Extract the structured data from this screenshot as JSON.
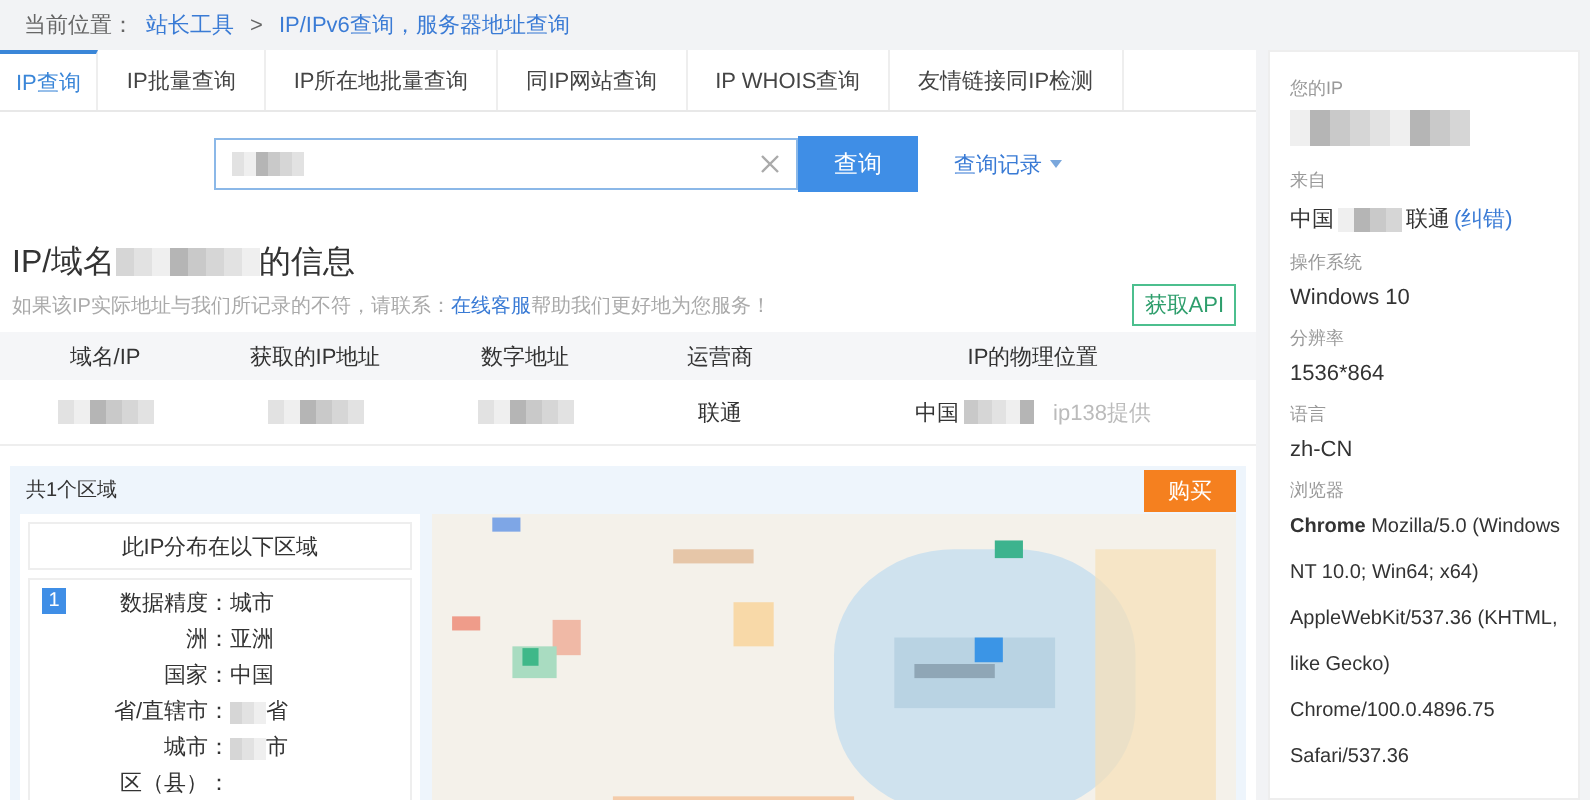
{
  "breadcrumb": {
    "label": "当前位置：",
    "separator": ">",
    "items": [
      "站长工具",
      "IP/IPv6查询，服务器地址查询"
    ]
  },
  "tabs": [
    {
      "label": "IP查询",
      "selected": true
    },
    {
      "label": "IP批量查询",
      "selected": false
    },
    {
      "label": "IP所在地批量查询",
      "selected": false
    },
    {
      "label": "同IP网站查询",
      "selected": false
    },
    {
      "label": "IP WHOIS查询",
      "selected": false
    },
    {
      "label": "友情链接同IP检测",
      "selected": false
    }
  ],
  "search": {
    "button": "查询",
    "history_link": "查询记录"
  },
  "info": {
    "title_prefix": "IP/域名",
    "title_suffix": "的信息",
    "notice_before": "如果该IP实际地址与我们所记录的不符，请联系：",
    "notice_link": "在线客服",
    "notice_after": "帮助我们更好地为您服务！",
    "api_button": "获取API"
  },
  "table": {
    "columns": [
      "域名/IP",
      "获取的IP地址",
      "数字地址",
      "运营商",
      "IP的物理位置"
    ],
    "row": [
      {
        "kind": "redacted"
      },
      {
        "kind": "redacted"
      },
      {
        "kind": "redacted"
      },
      {
        "kind": "text",
        "text": "联通"
      },
      {
        "kind": "location",
        "text": "中国",
        "note": "ip138提供"
      }
    ]
  },
  "region": {
    "count_label": "共1个区域",
    "buy_button": "购买",
    "card_title": "此IP分布在以下区域",
    "index": "1",
    "fields": [
      {
        "label": "数据精度：",
        "value": "城市",
        "kind": "plain"
      },
      {
        "label": "洲：",
        "value": "亚洲",
        "kind": "plain"
      },
      {
        "label": "国家：",
        "value": "中国",
        "kind": "plain"
      },
      {
        "label": "省/直辖市：",
        "value": "省",
        "kind": "redacted"
      },
      {
        "label": "城市：",
        "value": "市",
        "kind": "redacted"
      },
      {
        "label": "区（县）：",
        "kind": "plain"
      }
    ]
  },
  "sidebar": [
    {
      "label": "您的IP",
      "kind": "redacted"
    },
    {
      "label": "来自",
      "kind": "location",
      "value": "中国",
      "value_after": "联通",
      "link": "(纠错)"
    },
    {
      "label": "操作系统",
      "kind": "text",
      "value": "Windows 10"
    },
    {
      "label": "分辨率",
      "kind": "text",
      "value": "1536*864"
    },
    {
      "label": "语言",
      "kind": "text",
      "value": "zh-CN"
    },
    {
      "label": "浏览器",
      "kind": "rich",
      "value": "**Chrome** Mozilla/5.0 (Windows NT 10.0; Win64; x64) AppleWebKit/537.36 (KHTML, like Gecko) Chrome/100.0.4896.75 Safari/537.36"
    }
  ]
}
